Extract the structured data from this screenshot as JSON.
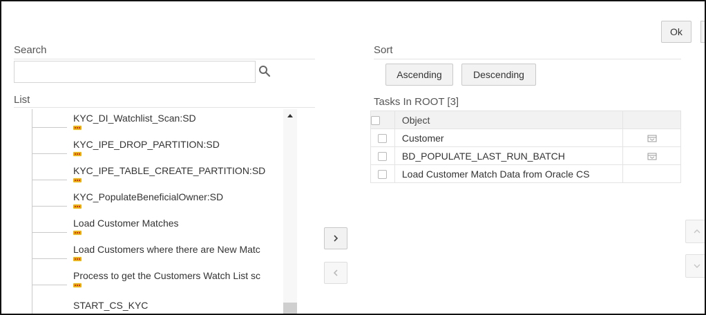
{
  "actions": {
    "ok_label": "Ok"
  },
  "left_panel": {
    "search_label": "Search",
    "search_value": "",
    "search_icon": "search-icon",
    "list_label": "List",
    "tree_items": [
      {
        "label": "KYC_DI_Watchlist_Scan:SD"
      },
      {
        "label": "KYC_IPE_DROP_PARTITION:SD"
      },
      {
        "label": "KYC_IPE_TABLE_CREATE_PARTITION:SD"
      },
      {
        "label": "KYC_PopulateBeneficialOwner:SD"
      },
      {
        "label": "Load Customer Matches"
      },
      {
        "label": "Load Customers where there are New Matc"
      },
      {
        "label": "Process to get the Customers Watch List sc"
      },
      {
        "label": "START_CS_KYC"
      }
    ]
  },
  "transfer": {
    "add_icon": "chevron-right-icon",
    "remove_icon": "chevron-left-icon"
  },
  "right_panel": {
    "sort_label": "Sort",
    "ascending_label": "Ascending",
    "descending_label": "Descending",
    "tasks_title": "Tasks In ROOT [3]",
    "object_header": "Object",
    "rows": [
      {
        "object": "Customer",
        "has_icon": true
      },
      {
        "object": "BD_POPULATE_LAST_RUN_BATCH",
        "has_icon": true
      },
      {
        "object": "Load Customer Match Data from Oracle CS",
        "has_icon": false
      }
    ],
    "move_up_icon": "chevron-up-icon",
    "move_down_icon": "chevron-down-icon"
  },
  "colors": {
    "node_dots": "#f0b400",
    "border": "#111111",
    "button_bg": "#f2f2f2"
  }
}
